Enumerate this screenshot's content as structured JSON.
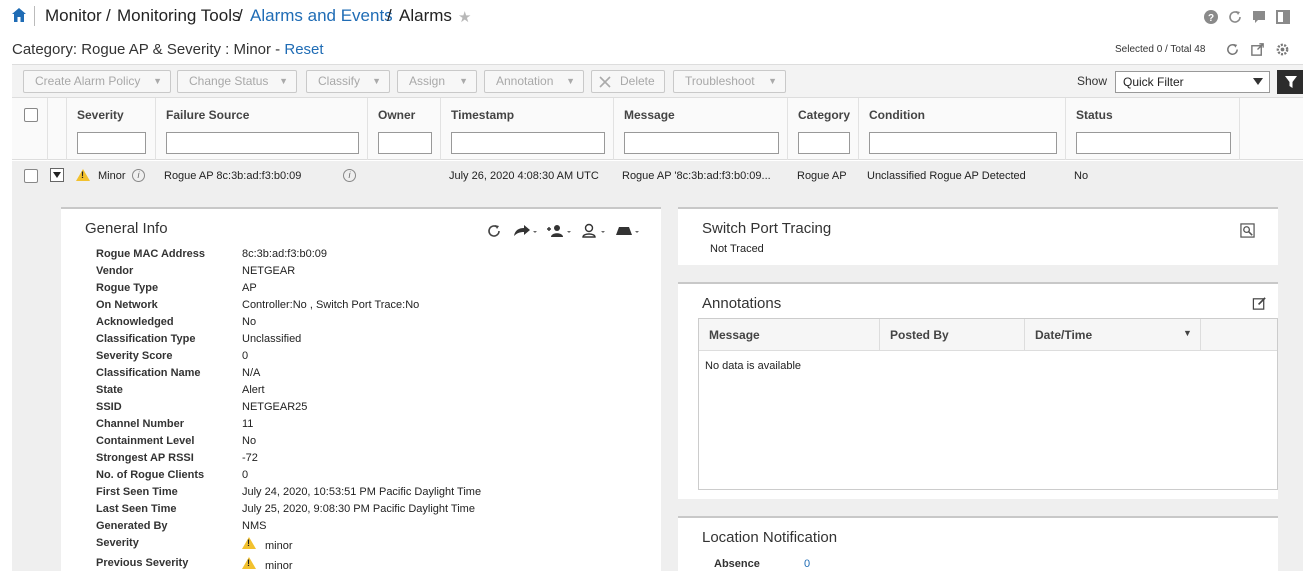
{
  "breadcrumb": {
    "home_icon": "home-icon",
    "items": [
      "Monitor",
      "Monitoring Tools",
      "Alarms and Events",
      "Alarms"
    ],
    "separator": "/"
  },
  "top_icons": [
    "help-icon",
    "refresh-icon",
    "chat-icon",
    "panel-icon"
  ],
  "category": {
    "text": "Category: Rogue AP & Severity : Minor -",
    "reset_label": "Reset"
  },
  "selection": {
    "text": "Selected 0 / Total 48"
  },
  "toolbar": {
    "buttons": [
      {
        "label": "Create Alarm Policy",
        "has_caret": true
      },
      {
        "label": "Change Status",
        "has_caret": true
      },
      {
        "label": "Classify",
        "has_caret": true
      },
      {
        "label": "Assign",
        "has_caret": true
      },
      {
        "label": "Annotation",
        "has_caret": true
      },
      {
        "label": "Delete",
        "has_caret": false
      },
      {
        "label": "Troubleshoot",
        "has_caret": true
      }
    ],
    "show_label": "Show",
    "quick_filter_value": "Quick Filter"
  },
  "table": {
    "columns": [
      "Severity",
      "Failure Source",
      "Owner",
      "Timestamp",
      "Message",
      "Category",
      "Condition",
      "Status"
    ],
    "row": {
      "severity": "Minor",
      "failure_source": "Rogue AP 8c:3b:ad:f3:b0:09",
      "owner": "",
      "timestamp": "July 26, 2020 4:08:30 AM UTC",
      "message": "Rogue AP '8c:3b:ad:f3:b0:09...",
      "category": "Rogue AP",
      "condition": "Unclassified Rogue AP Detected",
      "status": "No"
    }
  },
  "general_info": {
    "title": "General Info",
    "fields": [
      {
        "label": "Rogue MAC Address",
        "value": "8c:3b:ad:f3:b0:09"
      },
      {
        "label": "Vendor",
        "value": "NETGEAR"
      },
      {
        "label": "Rogue Type",
        "value": "AP"
      },
      {
        "label": "On Network",
        "value": "Controller:No , Switch Port Trace:No"
      },
      {
        "label": "Acknowledged",
        "value": "No"
      },
      {
        "label": "Classification Type",
        "value": "Unclassified"
      },
      {
        "label": "Severity Score",
        "value": "0"
      },
      {
        "label": "Classification Name",
        "value": "N/A"
      },
      {
        "label": "State",
        "value": "Alert"
      },
      {
        "label": "SSID",
        "value": "NETGEAR25"
      },
      {
        "label": "Channel Number",
        "value": "11"
      },
      {
        "label": "Containment Level",
        "value": "No"
      },
      {
        "label": "Strongest AP RSSI",
        "value": "-72"
      },
      {
        "label": "No. of Rogue Clients",
        "value": "0"
      },
      {
        "label": "First Seen Time",
        "value": "July 24, 2020, 10:53:51 PM Pacific Daylight Time"
      },
      {
        "label": "Last Seen Time",
        "value": "July 25, 2020, 9:08:30 PM Pacific Daylight Time"
      },
      {
        "label": "Generated By",
        "value": "NMS"
      },
      {
        "label": "Severity",
        "value": "minor"
      },
      {
        "label": "Previous Severity",
        "value": "minor"
      }
    ]
  },
  "switch_port": {
    "title": "Switch Port Tracing",
    "status": "Not Traced"
  },
  "annotations": {
    "title": "Annotations",
    "columns": [
      "Message",
      "Posted By",
      "Date/Time"
    ],
    "empty_text": "No data is available"
  },
  "location": {
    "title": "Location Notification",
    "absence_label": "Absence",
    "absence_value": "0"
  },
  "colors": {
    "link": "#1f6cb5",
    "warning": "#f2c12e",
    "row_bg": "#efefef"
  }
}
